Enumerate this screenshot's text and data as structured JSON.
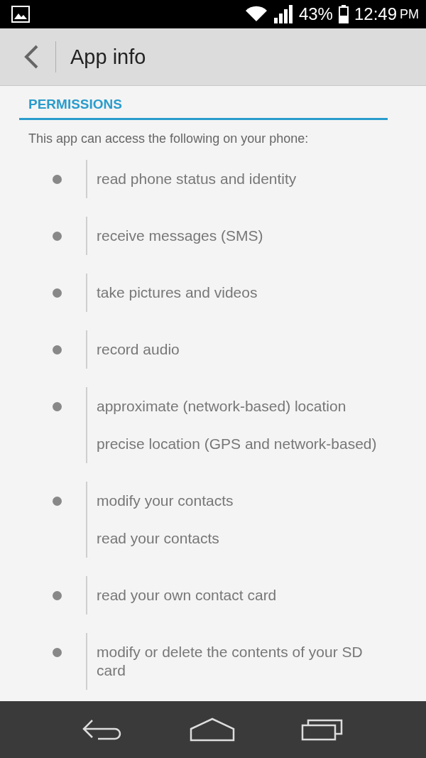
{
  "status_bar": {
    "battery_text": "43%",
    "time": "12:49",
    "meridiem": "PM"
  },
  "action_bar": {
    "title": "App info"
  },
  "section": {
    "title": "PERMISSIONS",
    "intro": "This app can access the following on your phone:"
  },
  "groups": [
    {
      "permissions": [
        "read phone status and identity"
      ]
    },
    {
      "permissions": [
        "receive messages (SMS)"
      ]
    },
    {
      "permissions": [
        "take pictures and videos"
      ]
    },
    {
      "permissions": [
        "record audio"
      ]
    },
    {
      "permissions": [
        "approximate (network-based) location",
        "precise location (GPS and network-based)"
      ]
    },
    {
      "permissions": [
        "modify your contacts",
        "read your contacts"
      ]
    },
    {
      "permissions": [
        "read your own contact card"
      ]
    },
    {
      "permissions": [
        "modify or delete the contents of your SD card"
      ]
    }
  ]
}
